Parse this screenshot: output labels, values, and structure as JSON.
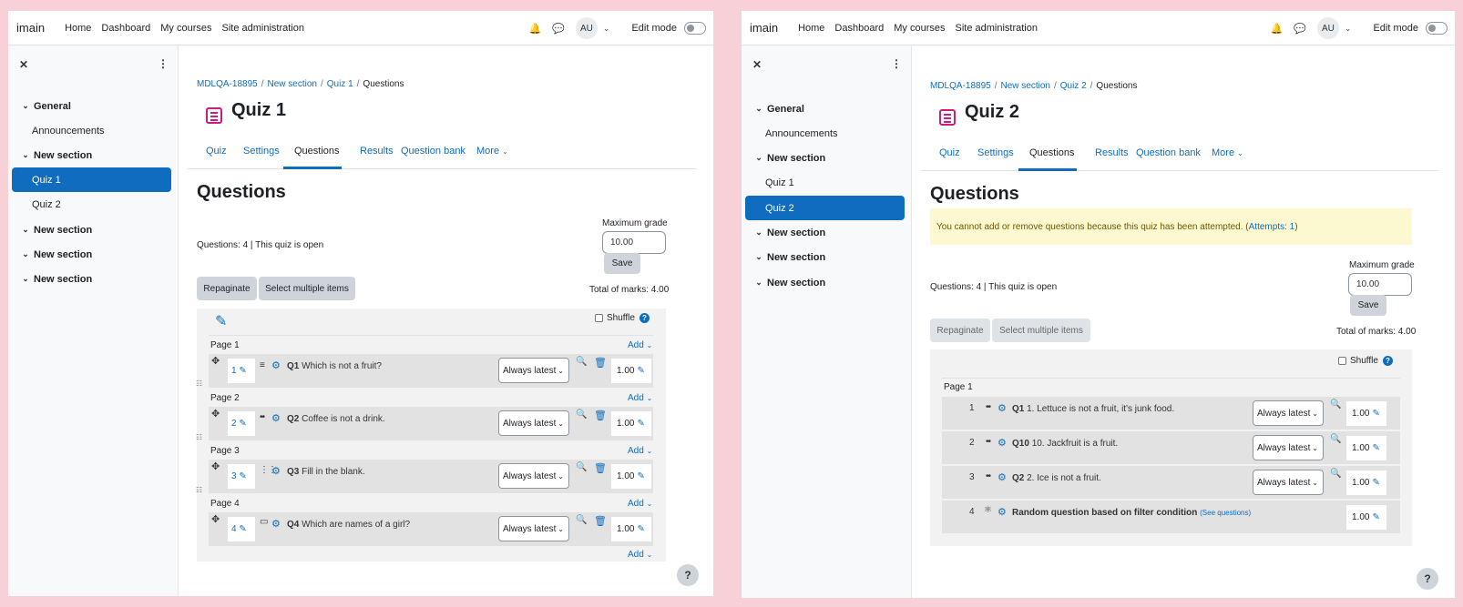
{
  "left": {
    "brand": "imain",
    "nav": [
      "Home",
      "Dashboard",
      "My courses",
      "Site administration"
    ],
    "avatar": "AU",
    "edit_mode_label": "Edit mode",
    "sidebar": {
      "sections": [
        {
          "label": "General",
          "items": [
            "Announcements"
          ]
        },
        {
          "label": "New section",
          "items": [
            "Quiz 1",
            "Quiz 2"
          ]
        },
        {
          "label": "New section",
          "items": []
        },
        {
          "label": "New section",
          "items": []
        },
        {
          "label": "New section",
          "items": []
        }
      ],
      "active": "Quiz 1"
    },
    "breadcrumb": [
      "MDLQA-18895",
      "New section",
      "Quiz 1",
      "Questions"
    ],
    "title": "Quiz 1",
    "tabs": [
      "Quiz",
      "Settings",
      "Questions",
      "Results",
      "Question bank",
      "More"
    ],
    "heading": "Questions",
    "info": "Questions: 4 | This quiz is open",
    "max_grade_label": "Maximum grade",
    "max_grade_value": "10.00",
    "save_label": "Save",
    "repaginate_label": "Repaginate",
    "select_multiple_label": "Select multiple items",
    "total_marks": "Total of marks: 4.00",
    "shuffle_label": "Shuffle",
    "add_label": "Add",
    "pages": [
      {
        "page": "Page 1",
        "num": "1",
        "qnum": "Q1",
        "text": "Which is not a fruit?",
        "version": "Always latest",
        "mark": "1.00"
      },
      {
        "page": "Page 2",
        "num": "2",
        "qnum": "Q2",
        "text": "Coffee is not a drink.",
        "version": "Always latest",
        "mark": "1.00"
      },
      {
        "page": "Page 3",
        "num": "3",
        "qnum": "Q3",
        "text": "Fill in the blank.",
        "version": "Always latest",
        "mark": "1.00"
      },
      {
        "page": "Page 4",
        "num": "4",
        "qnum": "Q4",
        "text": "Which are names of a girl?",
        "version": "Always latest",
        "mark": "1.00"
      }
    ]
  },
  "right": {
    "brand": "imain",
    "nav": [
      "Home",
      "Dashboard",
      "My courses",
      "Site administration"
    ],
    "avatar": "AU",
    "edit_mode_label": "Edit mode",
    "sidebar": {
      "sections": [
        {
          "label": "General",
          "items": [
            "Announcements"
          ]
        },
        {
          "label": "New section",
          "items": [
            "Quiz 1",
            "Quiz 2"
          ]
        },
        {
          "label": "New section",
          "items": []
        },
        {
          "label": "New section",
          "items": []
        },
        {
          "label": "New section",
          "items": []
        }
      ],
      "active": "Quiz 2"
    },
    "breadcrumb": [
      "MDLQA-18895",
      "New section",
      "Quiz 2",
      "Questions"
    ],
    "title": "Quiz 2",
    "tabs": [
      "Quiz",
      "Settings",
      "Questions",
      "Results",
      "Question bank",
      "More"
    ],
    "heading": "Questions",
    "alert_text": "You cannot add or remove questions because this quiz has been attempted. (",
    "alert_link": "Attempts: 1",
    "alert_end": ")",
    "info": "Questions: 4 | This quiz is open",
    "max_grade_label": "Maximum grade",
    "max_grade_value": "10.00",
    "save_label": "Save",
    "repaginate_label": "Repaginate",
    "select_multiple_label": "Select multiple items",
    "total_marks": "Total of marks: 4.00",
    "shuffle_label": "Shuffle",
    "page_label": "Page 1",
    "slots": [
      {
        "num": "1",
        "qnum": "Q1",
        "text": "1. Lettuce is not a fruit, it's junk food.",
        "version": "Always latest",
        "mark": "1.00"
      },
      {
        "num": "2",
        "qnum": "Q10",
        "text": "10. Jackfruit is a fruit.",
        "version": "Always latest",
        "mark": "1.00"
      },
      {
        "num": "3",
        "qnum": "Q2",
        "text": "2. Ice is not a fruit.",
        "version": "Always latest",
        "mark": "1.00"
      },
      {
        "num": "4",
        "qnum": "",
        "text": "Random question based on filter condition",
        "see": "(See questions)",
        "mark": "1.00"
      }
    ]
  }
}
